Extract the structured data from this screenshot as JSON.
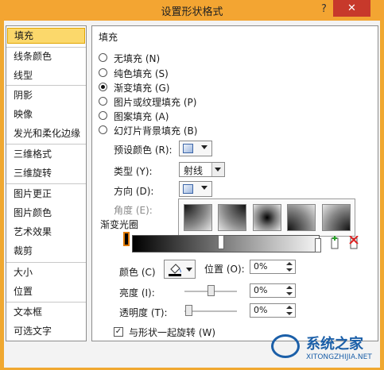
{
  "window": {
    "title": "设置形状格式",
    "help": "?",
    "close": "✕"
  },
  "sidebar": {
    "items": [
      "填充",
      "线条颜色",
      "线型",
      "阴影",
      "映像",
      "发光和柔化边缘",
      "三维格式",
      "三维旋转",
      "图片更正",
      "图片颜色",
      "艺术效果",
      "裁剪",
      "大小",
      "位置",
      "文本框",
      "可选文字"
    ],
    "selected": "填充"
  },
  "fill": {
    "heading": "填充",
    "options": [
      "无填充 (N)",
      "纯色填充 (S)",
      "渐变填充 (G)",
      "图片或纹理填充 (P)",
      "图案填充 (A)",
      "幻灯片背景填充 (B)"
    ],
    "selected": "渐变填充 (G)",
    "preset_label": "预设颜色 (R):",
    "type_label": "类型 (Y):",
    "type_value": "射线",
    "direction_label": "方向 (D):",
    "angle_label": "角度 (E):",
    "stops_label": "渐变光圈",
    "color_label": "颜色 (C)",
    "position_label": "位置 (O):",
    "position_value": "0%",
    "brightness_label": "亮度 (I):",
    "brightness_value": "0%",
    "transparency_label": "透明度 (T):",
    "transparency_value": "0%",
    "rotate_label": "与形状一起旋转 (W)",
    "rotate_checked": true
  },
  "direction_options": [
    "gradient-top-left",
    "gradient-top-right",
    "gradient-center",
    "gradient-bottom-left",
    "gradient-bottom-right"
  ],
  "watermark": {
    "name": "系统之家",
    "url": "XITONGZHIJIA.NET"
  },
  "colors": {
    "titlebar": "#f3a532",
    "close": "#c7392b",
    "selected": "#fbd86b"
  }
}
